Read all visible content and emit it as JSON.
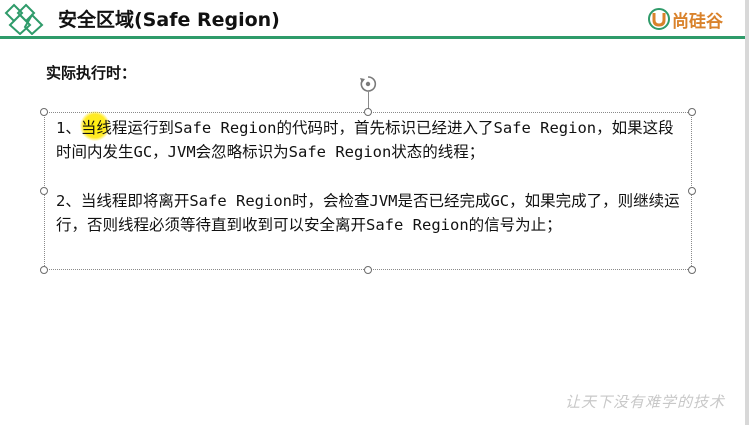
{
  "header": {
    "title": "安全区域(Safe Region)",
    "brand_text": "尚硅谷",
    "accent_color": "#2f9b6a",
    "brand_color": "#d9822b",
    "logo_icon": "diamond-logo-icon",
    "brand_icon": "u-brand-icon"
  },
  "body": {
    "subheading": "实际执行时：",
    "paragraph1": "1、当线程运行到Safe Region的代码时，首先标识已经进入了Safe Region，如果这段时间内发生GC，JVM会忽略标识为Safe Region状态的线程；",
    "paragraph2": "2、当线程即将离开Safe Region时，会检查JVM是否已经完成GC，如果完成了，则继续运行，否则线程必须等待直到收到可以安全离开Safe Region的信号为止；"
  },
  "footer": {
    "watermark": "让天下没有难学的技术"
  }
}
